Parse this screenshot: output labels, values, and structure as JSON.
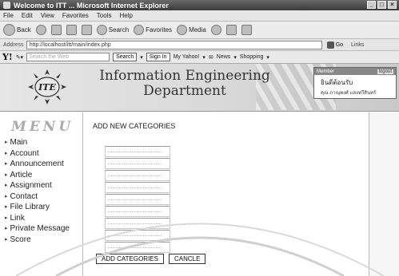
{
  "window": {
    "title": "Welcome to ITT ... Microsoft Internet Explorer",
    "controls": [
      "_",
      "□",
      "×"
    ]
  },
  "menubar": [
    "File",
    "Edit",
    "View",
    "Favorites",
    "Tools",
    "Help"
  ],
  "toolbar": {
    "back": "Back",
    "search": "Search",
    "favorites": "Favorites",
    "media": "Media"
  },
  "addressbar": {
    "label": "Address",
    "url": "http://localhost/itt/main/index.php",
    "go": "Go",
    "links": "Links"
  },
  "yahoobar": {
    "logo": "Y!",
    "search_placeholder": "Search the Web",
    "search_button": "Search",
    "signin": "Sign In",
    "my_yahoo": "My Yahoo!",
    "news": "News",
    "shopping": "Shopping"
  },
  "banner": {
    "logo_text": "ITE",
    "title_line1": "Information Engineering",
    "title_line2": "Department",
    "user_head": "Member",
    "logout": "logout",
    "welcome": "ยินดีต้อนรับ",
    "user_name": "คุณ ภาณุพงศ์ แสงทวีสินทร์"
  },
  "sidebar": {
    "title": "MENU",
    "items": [
      "Main",
      "Account",
      "Announcement",
      "Article",
      "Assignment",
      "Contact",
      "File Library",
      "Link",
      "Private Message",
      "Score"
    ]
  },
  "content": {
    "title": "ADD NEW CATEGORIES",
    "fields": [
      "",
      "",
      "",
      "",
      "",
      "",
      "",
      "",
      ""
    ],
    "submit": "ADD CATEGORIES",
    "cancel": "CANCLE"
  },
  "colors": {
    "title_bar": "#3a3a3a",
    "banner": "#d9d9d9",
    "menu_title": "#aaaaaa"
  }
}
